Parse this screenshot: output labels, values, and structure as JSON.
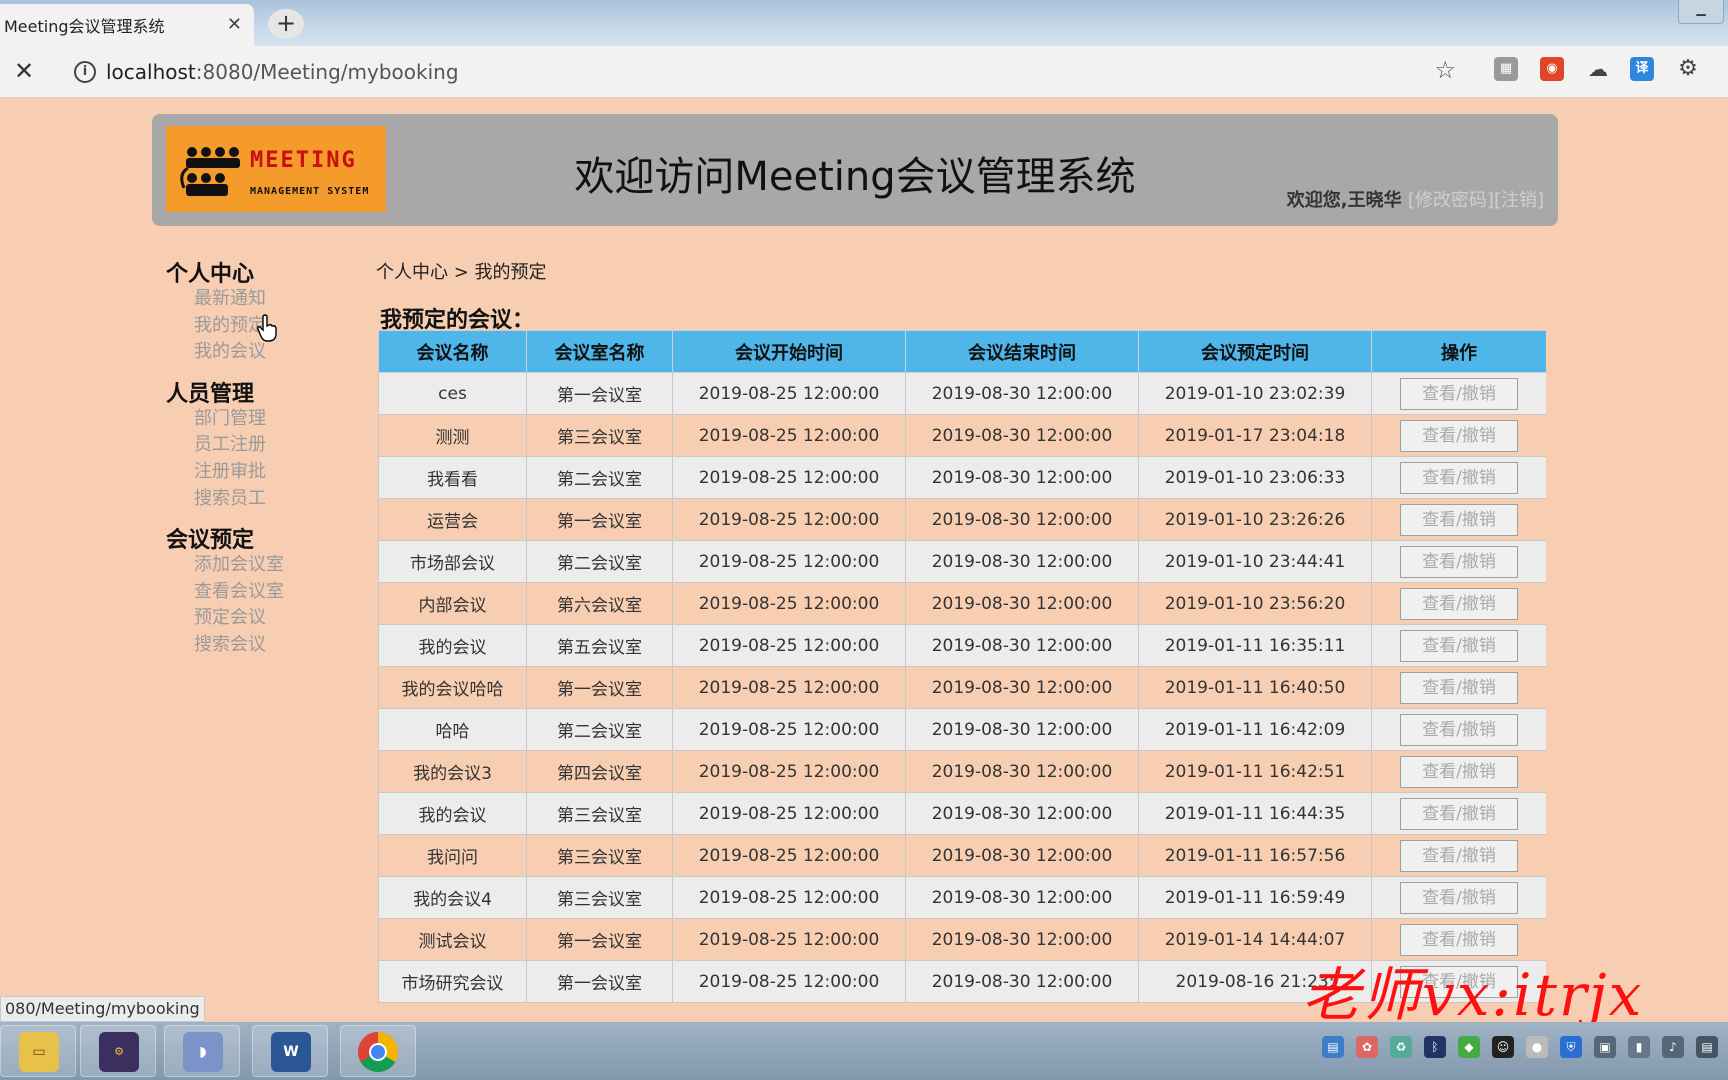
{
  "browser": {
    "tab_title": "Meeting会议管理系统",
    "tab_close": "✕",
    "new_tab": "+",
    "stop": "✕",
    "url_host": "localhost",
    "url_port_path": ":8080/Meeting/mybooking",
    "status_url": "080/Meeting/mybooking"
  },
  "header": {
    "logo_word": "MEETING",
    "logo_sub": "MANAGEMENT SYSTEM",
    "title": "欢迎访问Meeting会议管理系统",
    "welcome": "欢迎您,王晓华",
    "change_password": "[修改密码]",
    "logout": "[注销]"
  },
  "sidebar": {
    "groups": [
      {
        "title": "个人中心",
        "items": [
          "最新通知",
          "我的预定",
          "我的会议"
        ]
      },
      {
        "title": "人员管理",
        "items": [
          "部门管理",
          "员工注册",
          "注册审批",
          "搜索员工"
        ]
      },
      {
        "title": "会议预定",
        "items": [
          "添加会议室",
          "查看会议室",
          "预定会议",
          "搜索会议"
        ]
      }
    ]
  },
  "breadcrumb": "个人中心 > 我的预定",
  "section_title": "我预定的会议：",
  "table": {
    "headers": [
      "会议名称",
      "会议室名称",
      "会议开始时间",
      "会议结束时间",
      "会议预定时间",
      "操作"
    ],
    "action_label": "查看/撤销",
    "rows": [
      [
        "ces",
        "第一会议室",
        "2019-08-25 12:00:00",
        "2019-08-30 12:00:00",
        "2019-01-10 23:02:39"
      ],
      [
        "测测",
        "第三会议室",
        "2019-08-25 12:00:00",
        "2019-08-30 12:00:00",
        "2019-01-17 23:04:18"
      ],
      [
        "我看看",
        "第二会议室",
        "2019-08-25 12:00:00",
        "2019-08-30 12:00:00",
        "2019-01-10 23:06:33"
      ],
      [
        "运营会",
        "第一会议室",
        "2019-08-25 12:00:00",
        "2019-08-30 12:00:00",
        "2019-01-10 23:26:26"
      ],
      [
        "市场部会议",
        "第二会议室",
        "2019-08-25 12:00:00",
        "2019-08-30 12:00:00",
        "2019-01-10 23:44:41"
      ],
      [
        "内部会议",
        "第六会议室",
        "2019-08-25 12:00:00",
        "2019-08-30 12:00:00",
        "2019-01-10 23:56:20"
      ],
      [
        "我的会议",
        "第五会议室",
        "2019-08-25 12:00:00",
        "2019-08-30 12:00:00",
        "2019-01-11 16:35:11"
      ],
      [
        "我的会议哈哈",
        "第一会议室",
        "2019-08-25 12:00:00",
        "2019-08-30 12:00:00",
        "2019-01-11 16:40:50"
      ],
      [
        "哈哈",
        "第二会议室",
        "2019-08-25 12:00:00",
        "2019-08-30 12:00:00",
        "2019-01-11 16:42:09"
      ],
      [
        "我的会议3",
        "第四会议室",
        "2019-08-25 12:00:00",
        "2019-08-30 12:00:00",
        "2019-01-11 16:42:51"
      ],
      [
        "我的会议",
        "第三会议室",
        "2019-08-25 12:00:00",
        "2019-08-30 12:00:00",
        "2019-01-11 16:44:35"
      ],
      [
        "我问问",
        "第三会议室",
        "2019-08-25 12:00:00",
        "2019-08-30 12:00:00",
        "2019-01-11 16:57:56"
      ],
      [
        "我的会议4",
        "第三会议室",
        "2019-08-25 12:00:00",
        "2019-08-30 12:00:00",
        "2019-01-11 16:59:49"
      ],
      [
        "测试会议",
        "第一会议室",
        "2019-08-25 12:00:00",
        "2019-08-30 12:00:00",
        "2019-01-14 14:44:07"
      ],
      [
        "市场研究会议",
        "第一会议室",
        "2019-08-25 12:00:00",
        "2019-08-30 12:00:00",
        "2019-08-16 21:23:"
      ]
    ]
  },
  "watermark": "老师vx:itrjx",
  "taskbar": {
    "apps": [
      {
        "icon": "file-explorer-icon"
      },
      {
        "icon": "java-ee-ide-icon"
      },
      {
        "icon": "app-icon"
      },
      {
        "icon": "word-icon"
      },
      {
        "icon": "chrome-icon"
      }
    ]
  },
  "colors": {
    "page_bg": "#f8ceb3",
    "header_bg": "#a8a8a8",
    "table_header_bg": "#4fb6ea",
    "row_alt_bg": "#ececec",
    "logo_bg": "#f49b2c",
    "watermark": "#ff1010"
  }
}
